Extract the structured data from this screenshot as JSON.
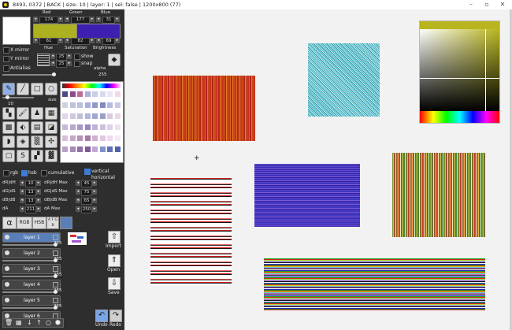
{
  "window": {
    "title": "8493, 0372 | BACK | size: 10 | layer: 1 | sel: false | 1200x800 (77)"
  },
  "color": {
    "labels": [
      "Red",
      "Green",
      "Blue"
    ],
    "rgb_values": [
      "174",
      "177",
      "31"
    ],
    "primary_hex": "#aeb11f",
    "secondary_hex": "#3d1fb1",
    "hsb_values": [
      "61",
      "82",
      "69"
    ],
    "hsb_labels": [
      "Hue",
      "Saturation",
      "Brightness"
    ]
  },
  "options": {
    "x_mirror": "X mirror",
    "y_mirror": "Y mirror",
    "antialias": "Antialias",
    "grid_values": [
      "25",
      "25"
    ],
    "show": "show",
    "snap": "snap",
    "alpha_label": "alpha",
    "alpha_value": "255"
  },
  "size": {
    "label": "size",
    "value": "10"
  },
  "blend": {
    "rgb": "rgb",
    "hsb": "hsb",
    "cumulative": "cumulative",
    "vertical": "vertical",
    "horizontal": "horizontal"
  },
  "jitter": {
    "rows": [
      {
        "label": "dR|dH",
        "value": "10",
        "max_label": "dR|dH Max",
        "max_value": "45"
      },
      {
        "label": "dG|dS",
        "value": "13",
        "max_label": "dG|dS Max",
        "max_value": "75"
      },
      {
        "label": "dB|dB",
        "value": "13",
        "max_label": "dB|dB Max",
        "max_value": "65"
      },
      {
        "label": "dA",
        "value": "211",
        "max_label": "dA Max",
        "max_value": "250"
      }
    ]
  },
  "mode_buttons": [
    "RGB",
    "HSB",
    "A F G B"
  ],
  "layers": [
    {
      "name": "layer 1",
      "opacity": "255",
      "selected": true
    },
    {
      "name": "layer 2",
      "opacity": "255",
      "selected": false
    },
    {
      "name": "layer 3",
      "opacity": "255",
      "selected": false
    },
    {
      "name": "layer 4",
      "opacity": "255",
      "selected": false
    },
    {
      "name": "layer 5",
      "opacity": "255",
      "selected": false
    },
    {
      "name": "layer 6",
      "opacity": "255",
      "selected": false
    }
  ],
  "actions": {
    "import": "Import",
    "open": "Open",
    "save": "Save",
    "undo": "Undo",
    "redo": "Redo"
  },
  "cursor": "+"
}
